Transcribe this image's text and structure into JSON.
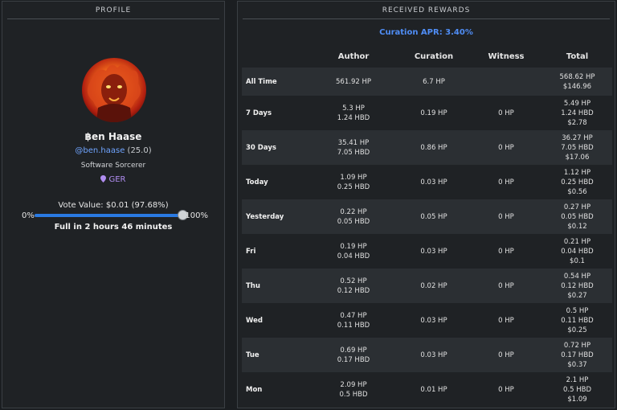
{
  "profile": {
    "panel_title": "PROFILE",
    "name": "฿en Haase",
    "handle": "@ben.haase",
    "reputation": "(25.0)",
    "tagline": "Software Sorcerer",
    "location": "GER",
    "vote_value": "Vote Value: $0.01 (97.68%)",
    "slider_min": "0%",
    "slider_max": "100%",
    "slider_level": 0.9768,
    "full_in": "Full in 2 hours 46 minutes"
  },
  "rewards": {
    "panel_title": "RECEIVED REWARDS",
    "curation_apr": "Curation APR: 3.40%",
    "columns": [
      "",
      "Author",
      "Curation",
      "Witness",
      "Total"
    ],
    "rows": [
      {
        "label": "All Time",
        "author": [
          "561.92 HP"
        ],
        "curation": "6.7 HP",
        "witness": "",
        "total": [
          "568.62 HP",
          "$146.96"
        ]
      },
      {
        "label": "7 Days",
        "author": [
          "5.3 HP",
          "1.24 HBD"
        ],
        "curation": "0.19 HP",
        "witness": "0 HP",
        "total": [
          "5.49 HP",
          "1.24 HBD",
          "$2.78"
        ]
      },
      {
        "label": "30 Days",
        "author": [
          "35.41 HP",
          "7.05 HBD"
        ],
        "curation": "0.86 HP",
        "witness": "0 HP",
        "total": [
          "36.27 HP",
          "7.05 HBD",
          "$17.06"
        ]
      },
      {
        "label": "Today",
        "author": [
          "1.09 HP",
          "0.25 HBD"
        ],
        "curation": "0.03 HP",
        "witness": "0 HP",
        "total": [
          "1.12 HP",
          "0.25 HBD",
          "$0.56"
        ]
      },
      {
        "label": "Yesterday",
        "author": [
          "0.22 HP",
          "0.05 HBD"
        ],
        "curation": "0.05 HP",
        "witness": "0 HP",
        "total": [
          "0.27 HP",
          "0.05 HBD",
          "$0.12"
        ]
      },
      {
        "label": "Fri",
        "author": [
          "0.19 HP",
          "0.04 HBD"
        ],
        "curation": "0.03 HP",
        "witness": "0 HP",
        "total": [
          "0.21 HP",
          "0.04 HBD",
          "$0.1"
        ]
      },
      {
        "label": "Thu",
        "author": [
          "0.52 HP",
          "0.12 HBD"
        ],
        "curation": "0.02 HP",
        "witness": "0 HP",
        "total": [
          "0.54 HP",
          "0.12 HBD",
          "$0.27"
        ]
      },
      {
        "label": "Wed",
        "author": [
          "0.47 HP",
          "0.11 HBD"
        ],
        "curation": "0.03 HP",
        "witness": "0 HP",
        "total": [
          "0.5 HP",
          "0.11 HBD",
          "$0.25"
        ]
      },
      {
        "label": "Tue",
        "author": [
          "0.69 HP",
          "0.17 HBD"
        ],
        "curation": "0.03 HP",
        "witness": "0 HP",
        "total": [
          "0.72 HP",
          "0.17 HBD",
          "$0.37"
        ]
      },
      {
        "label": "Mon",
        "author": [
          "2.09 HP",
          "0.5 HBD"
        ],
        "curation": "0.01 HP",
        "witness": "0 HP",
        "total": [
          "2.1 HP",
          "0.5 HBD",
          "$1.09"
        ]
      }
    ]
  },
  "colors": {
    "accent": "#2a7ae2",
    "link": "#6fa4ff",
    "location": "#b08df0",
    "apr": "#4f8df5"
  },
  "icons": {
    "avatar": "fire-lion-avatar",
    "location": "location-pin-icon"
  }
}
